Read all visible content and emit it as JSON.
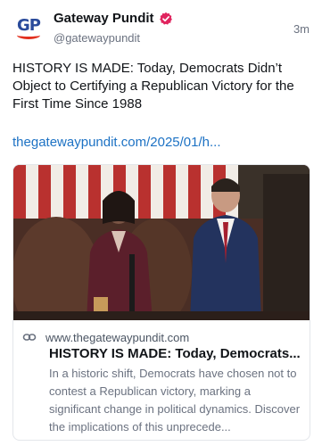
{
  "author": {
    "avatar_text": "GP",
    "display_name": "Gateway Pundit",
    "handle": "@gatewaypundit",
    "verified": true
  },
  "post": {
    "timestamp": "3m",
    "text": "HISTORY IS MADE: Today, Democrats Didn’t Object to Certifying a Republican Victory for the First Time Since 1988",
    "link_text": "thegatewaypundit.com/2025/01/h..."
  },
  "link_card": {
    "domain": "www.thegatewaypundit.com",
    "title": "HISTORY IS MADE: Today, Democrats...",
    "description": "In a historic shift, Democrats have chosen not to contest a Republican victory, marking a significant change in political dynamics. Discover the implications of this unprecede..."
  },
  "colors": {
    "text_primary": "#111418",
    "text_secondary": "#6b7280",
    "link": "#1d72c4",
    "verified_badge": "#e0245e",
    "avatar_blue": "#2a4b9b",
    "avatar_red": "#e2301f",
    "card_border": "#e3e6ea"
  },
  "icons": {
    "verified": "verified-badge-icon",
    "link": "link-icon"
  }
}
